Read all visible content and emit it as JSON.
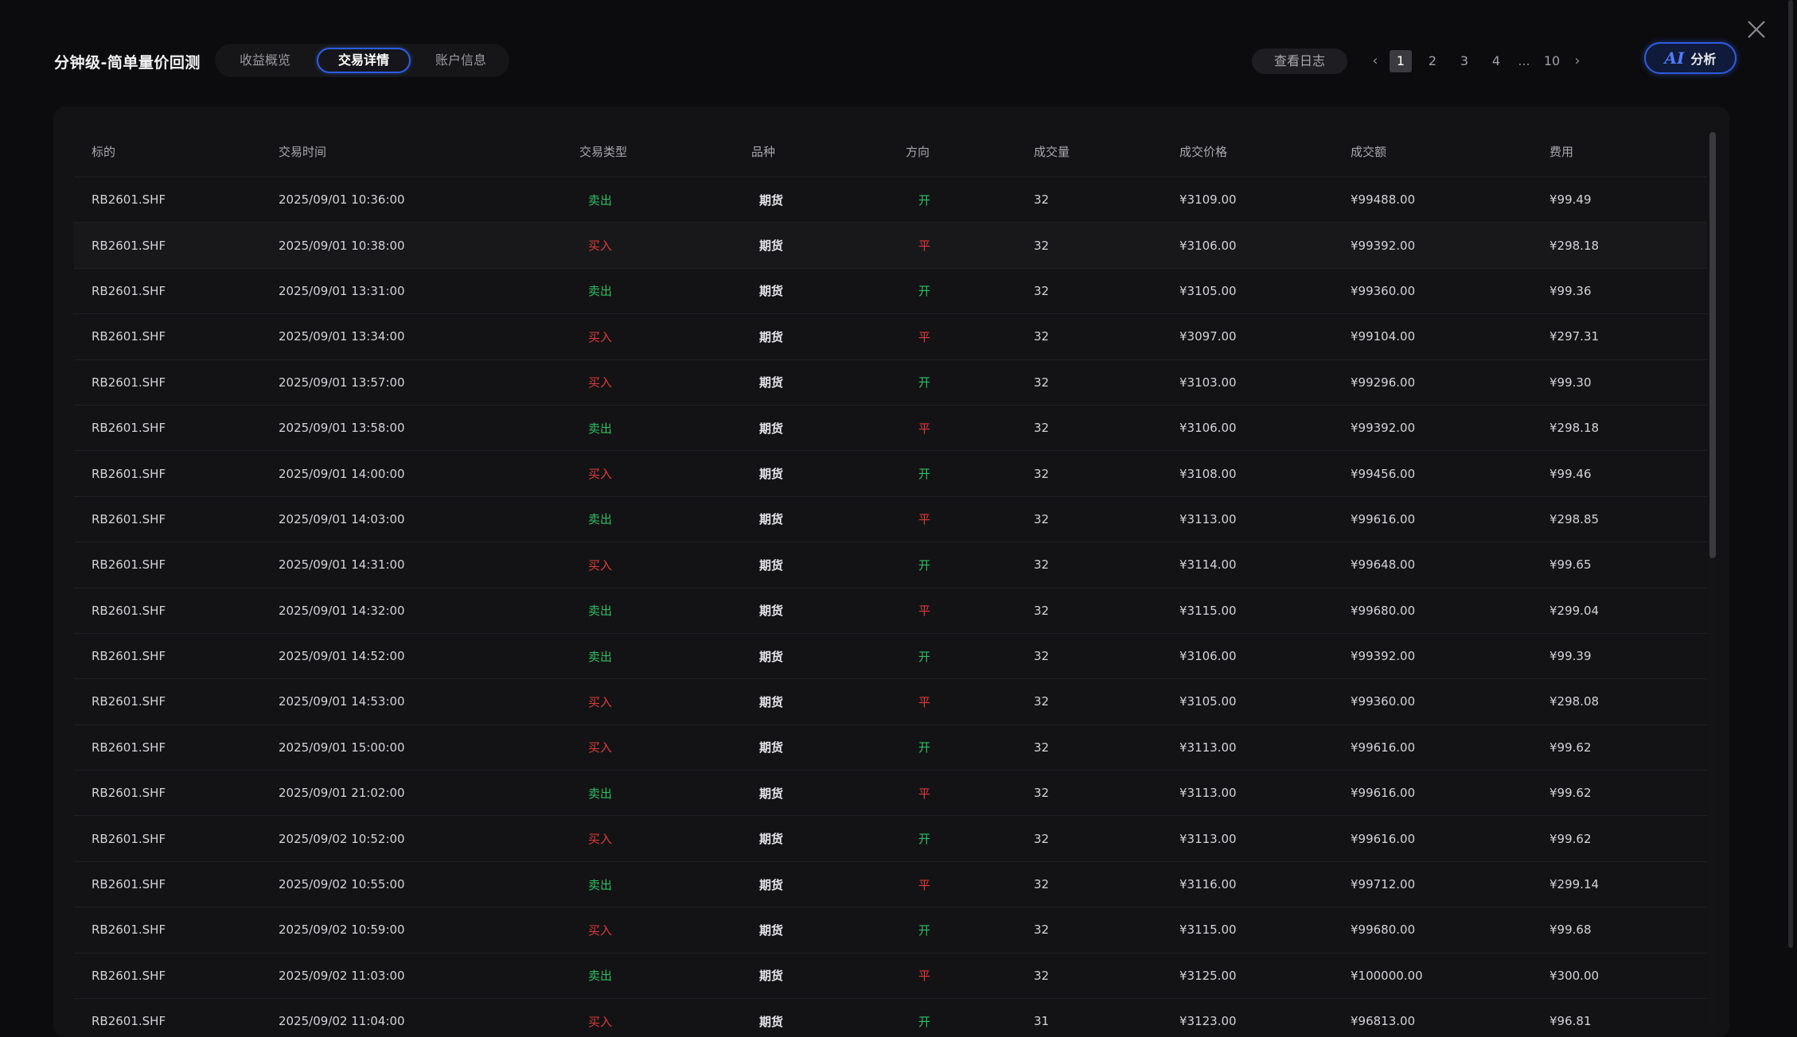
{
  "header": {
    "title": "分钟级-简单量价回测",
    "tabs": [
      {
        "label": "收益概览"
      },
      {
        "label": "交易详情"
      },
      {
        "label": "账户信息"
      }
    ],
    "log_button": "查看日志",
    "pagination": {
      "pages": [
        "1",
        "2",
        "3",
        "4"
      ],
      "ellipsis": "...",
      "last": "10",
      "current": "1",
      "prev": "‹",
      "next": "›"
    },
    "ai_button": {
      "mark": "AI",
      "label": "分析"
    }
  },
  "table": {
    "columns": [
      "标的",
      "交易时间",
      "交易类型",
      "品种",
      "方向",
      "成交量",
      "成交价格",
      "成交额",
      "费用"
    ],
    "rows": [
      [
        "RB2601.SHF",
        "2025/09/01 10:36:00",
        "卖出",
        "期货",
        "开",
        "32",
        "¥3109.00",
        "¥99488.00",
        "¥99.49"
      ],
      [
        "RB2601.SHF",
        "2025/09/01 10:38:00",
        "买入",
        "期货",
        "平",
        "32",
        "¥3106.00",
        "¥99392.00",
        "¥298.18"
      ],
      [
        "RB2601.SHF",
        "2025/09/01 13:31:00",
        "卖出",
        "期货",
        "开",
        "32",
        "¥3105.00",
        "¥99360.00",
        "¥99.36"
      ],
      [
        "RB2601.SHF",
        "2025/09/01 13:34:00",
        "买入",
        "期货",
        "平",
        "32",
        "¥3097.00",
        "¥99104.00",
        "¥297.31"
      ],
      [
        "RB2601.SHF",
        "2025/09/01 13:57:00",
        "买入",
        "期货",
        "开",
        "32",
        "¥3103.00",
        "¥99296.00",
        "¥99.30"
      ],
      [
        "RB2601.SHF",
        "2025/09/01 13:58:00",
        "卖出",
        "期货",
        "平",
        "32",
        "¥3106.00",
        "¥99392.00",
        "¥298.18"
      ],
      [
        "RB2601.SHF",
        "2025/09/01 14:00:00",
        "买入",
        "期货",
        "开",
        "32",
        "¥3108.00",
        "¥99456.00",
        "¥99.46"
      ],
      [
        "RB2601.SHF",
        "2025/09/01 14:03:00",
        "卖出",
        "期货",
        "平",
        "32",
        "¥3113.00",
        "¥99616.00",
        "¥298.85"
      ],
      [
        "RB2601.SHF",
        "2025/09/01 14:31:00",
        "买入",
        "期货",
        "开",
        "32",
        "¥3114.00",
        "¥99648.00",
        "¥99.65"
      ],
      [
        "RB2601.SHF",
        "2025/09/01 14:32:00",
        "卖出",
        "期货",
        "平",
        "32",
        "¥3115.00",
        "¥99680.00",
        "¥299.04"
      ],
      [
        "RB2601.SHF",
        "2025/09/01 14:52:00",
        "卖出",
        "期货",
        "开",
        "32",
        "¥3106.00",
        "¥99392.00",
        "¥99.39"
      ],
      [
        "RB2601.SHF",
        "2025/09/01 14:53:00",
        "买入",
        "期货",
        "平",
        "32",
        "¥3105.00",
        "¥99360.00",
        "¥298.08"
      ],
      [
        "RB2601.SHF",
        "2025/09/01 15:00:00",
        "买入",
        "期货",
        "开",
        "32",
        "¥3113.00",
        "¥99616.00",
        "¥99.62"
      ],
      [
        "RB2601.SHF",
        "2025/09/01 21:02:00",
        "卖出",
        "期货",
        "平",
        "32",
        "¥3113.00",
        "¥99616.00",
        "¥99.62"
      ],
      [
        "RB2601.SHF",
        "2025/09/02 10:52:00",
        "买入",
        "期货",
        "开",
        "32",
        "¥3113.00",
        "¥99616.00",
        "¥99.62"
      ],
      [
        "RB2601.SHF",
        "2025/09/02 10:55:00",
        "卖出",
        "期货",
        "平",
        "32",
        "¥3116.00",
        "¥99712.00",
        "¥299.14"
      ],
      [
        "RB2601.SHF",
        "2025/09/02 10:59:00",
        "买入",
        "期货",
        "开",
        "32",
        "¥3115.00",
        "¥99680.00",
        "¥99.68"
      ],
      [
        "RB2601.SHF",
        "2025/09/02 11:03:00",
        "卖出",
        "期货",
        "平",
        "32",
        "¥3125.00",
        "¥100000.00",
        "¥300.00"
      ],
      [
        "RB2601.SHF",
        "2025/09/02 11:04:00",
        "买入",
        "期货",
        "开",
        "31",
        "¥3123.00",
        "¥96813.00",
        "¥96.81"
      ]
    ]
  },
  "colors": {
    "sell": "#2fbf63",
    "buy": "#e03b3b",
    "accent": "#2f5de0"
  }
}
